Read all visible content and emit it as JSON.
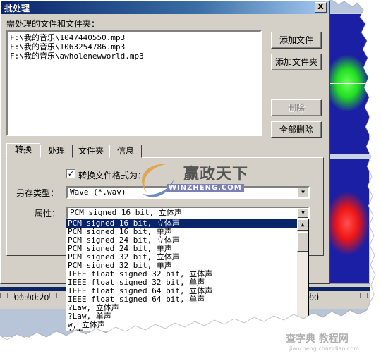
{
  "dialog": {
    "title": "批处理",
    "close_label": "X",
    "files_label": "需处理的文件和文件夹：",
    "files": [
      "F:\\我的音乐\\1047440550.mp3",
      "F:\\我的音乐\\1063254786.mp3",
      "F:\\我的音乐\\awholenewworld.mp3"
    ],
    "buttons": {
      "add_file": "添加文件",
      "add_folder": "添加文件夹",
      "delete": "删除",
      "delete_all": "全部删除"
    },
    "tabs": [
      {
        "label": "转换"
      },
      {
        "label": "处理"
      },
      {
        "label": "文件夹"
      },
      {
        "label": "信息"
      }
    ],
    "convert": {
      "checkbox_label": "转换文件格式为：",
      "checkbox_checked": true,
      "save_type_label": "另存类型：",
      "save_type_value": "Wave (*.wav)",
      "attr_label": "属性：",
      "attr_value": "PCM signed 16 bit, 立体声",
      "options": [
        "PCM signed 16 bit, 立体声",
        "PCM signed 16 bit, 单声",
        "PCM signed 24 bit, 立体声",
        "PCM signed 24 bit, 单声",
        "PCM signed 32 bit, 立体声",
        "PCM signed 32 bit, 单声",
        "IEEE float signed 32 bit, 立体声",
        "IEEE float signed 32 bit, 单声",
        "IEEE float signed 64 bit, 立体声",
        "IEEE float signed 64 bit, 单声",
        "?Law, 立体声",
        "?Law, 单声",
        "w, 立体声",
        "单声"
      ]
    }
  },
  "background": {
    "time_label_1": "00:00:20",
    "time_label_2": "00"
  },
  "watermark": {
    "logo_cn": "赢政天下",
    "logo_en": "WINZHENG.COM",
    "site": "查字典 教程网",
    "site_url": "jiaocheng.chazidian.com"
  },
  "colors": {
    "title_bar": "#0a246a",
    "track_bg": "#1b1fa3",
    "wave_green": "#22e022",
    "wave_red": "#ee1515",
    "selection": "#0a246a"
  }
}
